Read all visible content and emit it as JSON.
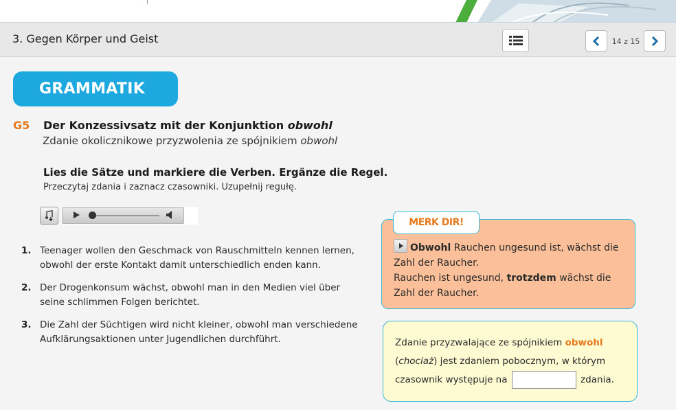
{
  "header": {
    "title": "3. Gegen Körper und Geist",
    "page_info": "14 z 15"
  },
  "section": {
    "badge": "GRAMMATIK",
    "code": "G5",
    "heading_de_prefix": "Der Konzessivsatz mit der Konjunktion ",
    "heading_de_keyword": "obwohl",
    "heading_pl_prefix": "Zdanie okolicznikowe przyzwolenia ze spójnikiem ",
    "heading_pl_keyword": "obwohl",
    "task_de": "Lies die Sätze und markiere die Verben. Ergänze die Regel.",
    "task_pl": "Przeczytaj zdania i zaznacz czasowniki. Uzupełnij regułę."
  },
  "items": [
    {
      "num": "1.",
      "text": "Teenager wollen den Geschmack von Rauschmitteln kennen lernen, obwohl der erste Kontakt damit unterschiedlich enden kann."
    },
    {
      "num": "2.",
      "text": "Der Drogenkonsum wächst, obwohl man in den Medien viel über seine schlimmen Folgen berichtet."
    },
    {
      "num": "3.",
      "text": "Die Zahl der Süchtigen wird nicht kleiner, obwohl man verschiedene Aufklärungsaktionen unter Jugendlichen durchführt."
    }
  ],
  "merk": {
    "label": "MERK DIR!",
    "line1_bold": "Obwohl",
    "line1_rest": " Rauchen ungesund ist, wächst die Zahl der Raucher.",
    "line2_prefix": "Rauchen ist ungesund, ",
    "line2_bold": "trotzdem",
    "line2_rest": " wächst die Zahl der Raucher."
  },
  "rule": {
    "part1": "Zdanie przyzwalające ze spójnikiem ",
    "keyword": "obwohl",
    "part2_open": "(",
    "part2_italic": "chociaż",
    "part2_rest": ") jest zdaniem pobocznym, w którym czasownik występuje na ",
    "blank_value": "",
    "part3": " zdania."
  },
  "colors": {
    "accent_blue": "#1ea8e0",
    "accent_orange": "#e67a1e",
    "merk_bg": "#fbc09a",
    "rule_bg": "#fefbd3"
  }
}
